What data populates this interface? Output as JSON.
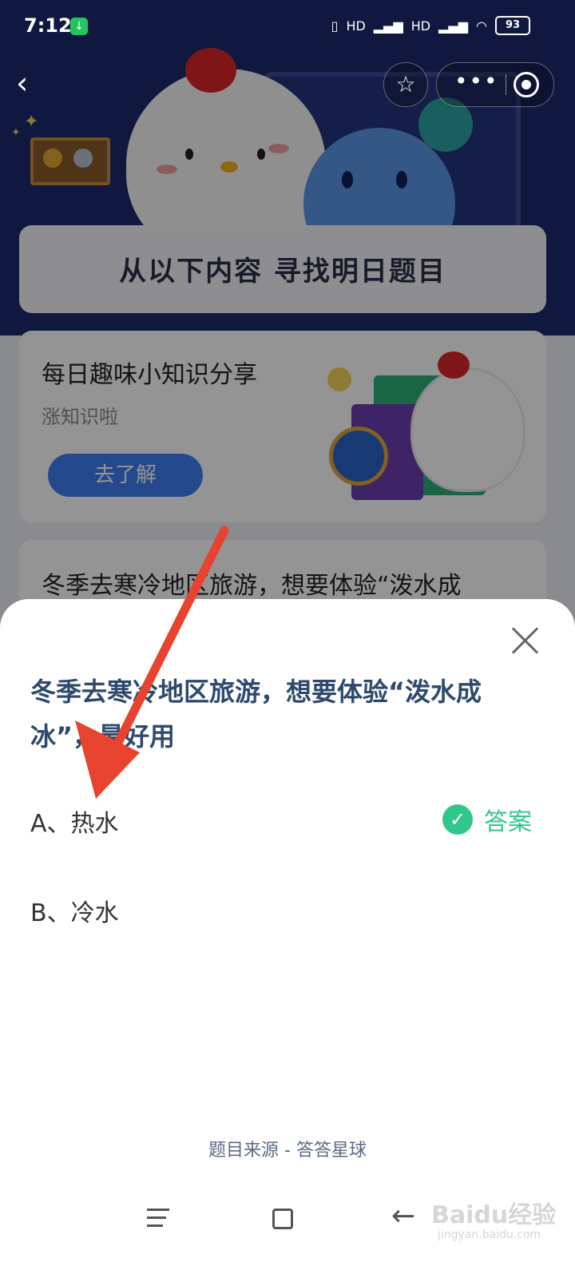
{
  "status_bar": {
    "time": "7:12",
    "network_labels": [
      "HD",
      "HD"
    ],
    "battery": "93"
  },
  "nav": {
    "back_icon": "chevron-left-icon",
    "favorite_icon": "star-icon",
    "more_icon": "more-dots-icon",
    "exit_icon": "target-icon"
  },
  "background_page": {
    "banner_title": "从以下内容  寻找明日题目",
    "card1": {
      "title": "每日趣味小知识分享",
      "subtitle": "涨知识啦",
      "button_label": "去了解"
    },
    "card2": {
      "text": "冬季去寒冷地区旅游，想要体验“泼水成"
    }
  },
  "sheet": {
    "question_line1": "冬季去寒冷地区旅游，想要体验“泼水成",
    "question_line2": "冰”，最好用",
    "options": [
      {
        "label": "A、热水",
        "is_answer": true
      },
      {
        "label": "B、冷水",
        "is_answer": false
      }
    ],
    "answer_tag": "答案",
    "source_text": "题目来源 - 答答星球"
  },
  "watermark": {
    "text": "Baidu经验",
    "sub": "jingyan.baidu.com"
  },
  "colors": {
    "accent_green": "#2fc78a",
    "question_blue": "#2d4a6e",
    "annotation_red": "#e8432e"
  }
}
